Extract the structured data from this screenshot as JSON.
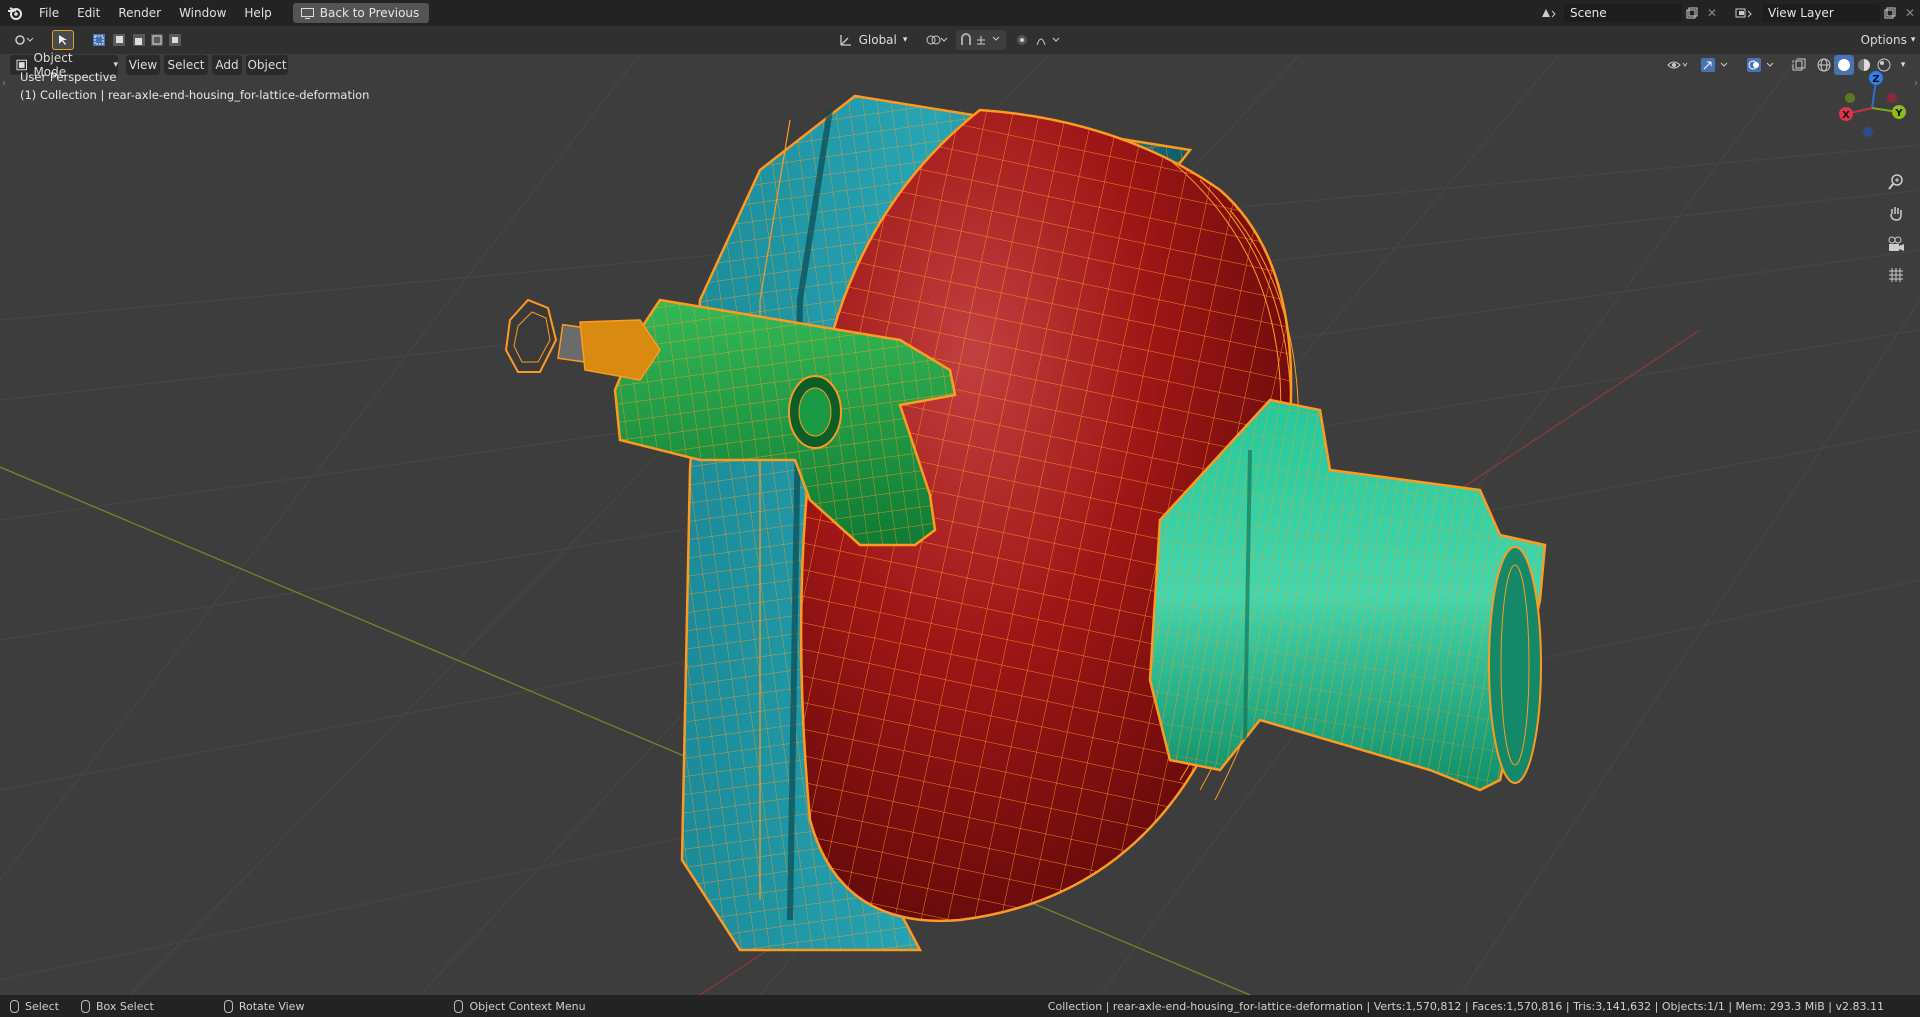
{
  "topbar": {
    "menu": [
      "File",
      "Edit",
      "Render",
      "Window",
      "Help"
    ],
    "back_label": "Back to Previous",
    "scene_value": "Scene",
    "view_layer_value": "View Layer"
  },
  "header": {
    "mode_label": "Object Mode",
    "menus": [
      "View",
      "Select",
      "Add",
      "Object"
    ],
    "transform_orientation": "Global",
    "options_label": "Options"
  },
  "viewport": {
    "perspective_label": "User Perspective",
    "collection_label": "(1) Collection | rear-axle-end-housing_for-lattice-deformation",
    "gizmo": {
      "x": "X",
      "y": "Y",
      "z": "Z"
    }
  },
  "statusbar": {
    "left_select": "Select",
    "box_select": "Box Select",
    "rotate_view": "Rotate View",
    "context_menu": "Object Context Menu",
    "stats": "Collection | rear-axle-end-housing_for-lattice-deformation | Verts:1,570,812 | Faces:1,570,816 | Tris:3,141,632 | Objects:1/1 | Mem: 293.3 MiB | v2.83.11"
  },
  "colors": {
    "background": "#3d3d3d",
    "grid_line": "#484848",
    "x_axis": "#8a3a3a",
    "y_axis": "#6b8a2c",
    "wire": "#ff9a20",
    "red_body": "#9c1414",
    "teal_plate": "#1f9aa8",
    "green_arm": "#23a34a",
    "mint_hub": "#1fb486"
  },
  "icons": [
    "blender-logo",
    "editor-type-icon",
    "select-cursor-icon",
    "box-select-mode-icons",
    "transform-orientation-icon",
    "pivot-icon",
    "snap-icon",
    "proportional-edit-icon",
    "visibility-icon",
    "gizmo-icon",
    "overlay-icon",
    "xray-icon",
    "shading-wire-icon",
    "shading-solid-icon",
    "shading-material-icon",
    "shading-rendered-icon",
    "zoom-icon",
    "pan-hand-icon",
    "camera-icon",
    "grid-view-icon"
  ]
}
